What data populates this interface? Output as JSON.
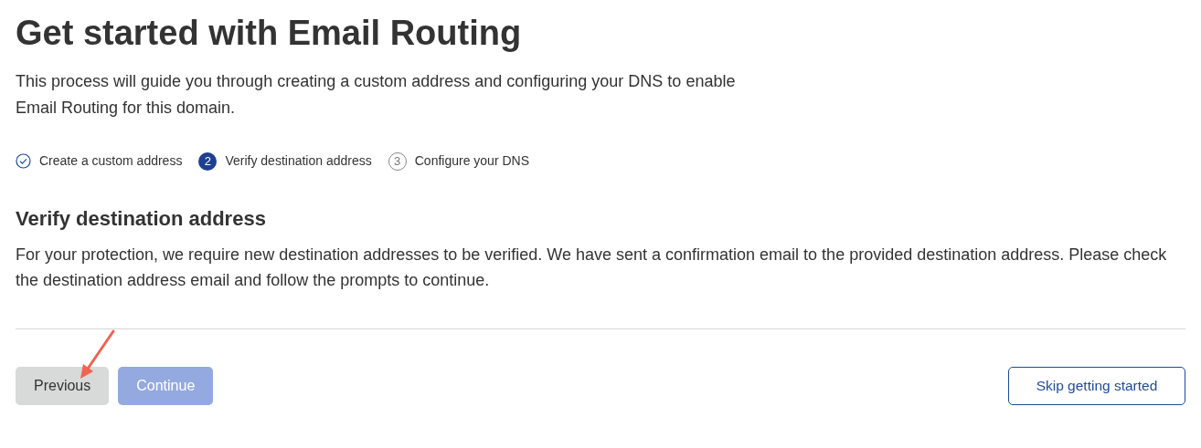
{
  "title": "Get started with Email Routing",
  "intro": "This process will guide you through creating a custom address and configuring your DNS to enable Email Routing for this domain.",
  "steps": [
    {
      "label": "Create a custom address",
      "completed": true,
      "selected": false
    },
    {
      "number": "2",
      "label": "Verify destination address",
      "completed": false,
      "selected": true
    },
    {
      "number": "3",
      "label": "Configure your DNS",
      "completed": false,
      "selected": false
    }
  ],
  "section": {
    "heading": "Verify destination address",
    "text": "For your protection, we require new destination addresses to be verified. We have sent a confirmation email to the provided destination address. Please check the destination address email and follow the prompts to continue."
  },
  "buttons": {
    "previous": {
      "label": "Previous",
      "disabled": false
    },
    "continue": {
      "label": "Continue",
      "disabled": true
    },
    "skip": {
      "label": "Skip getting started"
    }
  }
}
